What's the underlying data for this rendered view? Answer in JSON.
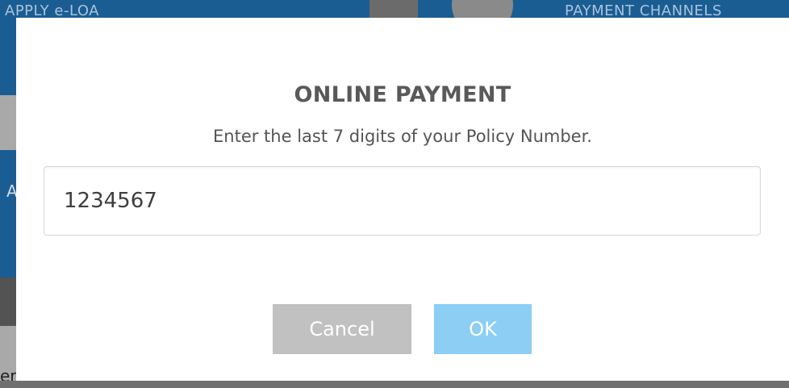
{
  "background": {
    "top_left_text": "APPLY e-LOA",
    "top_right_text": "PAYMENT CHANNELS",
    "left_letter": "A",
    "bottom_text": "er"
  },
  "dialog": {
    "title": "ONLINE PAYMENT",
    "message": "Enter the last 7 digits of your Policy Number.",
    "input_value": "1234567",
    "cancel_label": "Cancel",
    "ok_label": "OK"
  },
  "colors": {
    "ok_button": "#8ccef4",
    "cancel_button": "#c1c1c1",
    "background_blue": "#1a5d93"
  }
}
